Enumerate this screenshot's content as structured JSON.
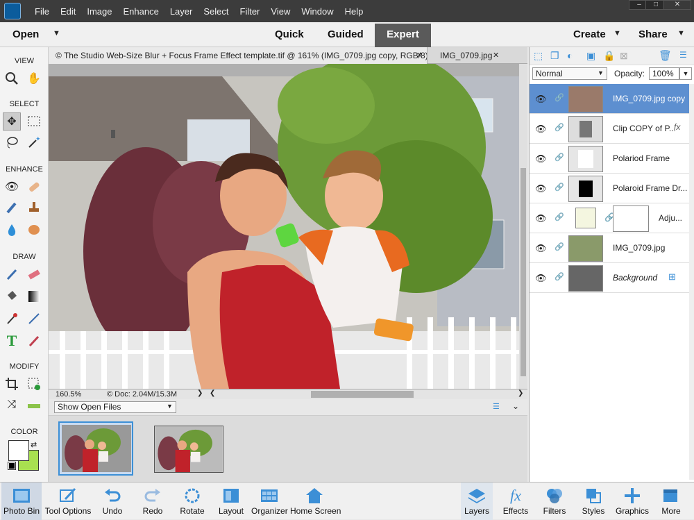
{
  "menubar": {
    "items": [
      "File",
      "Edit",
      "Image",
      "Enhance",
      "Layer",
      "Select",
      "Filter",
      "View",
      "Window",
      "Help"
    ],
    "window_controls": [
      "–",
      "□",
      "✕"
    ]
  },
  "modebar": {
    "open_label": "Open",
    "modes": [
      "Quick",
      "Guided",
      "Expert"
    ],
    "create_label": "Create",
    "share_label": "Share"
  },
  "toolbox": {
    "sections": [
      "VIEW",
      "SELECT",
      "ENHANCE",
      "DRAW",
      "MODIFY",
      "COLOR"
    ]
  },
  "tabs": {
    "active": "© The Studio Web-Size Blur + Focus Frame Effect template.tif @ 161% (IMG_0709.jpg copy, RGB/8) *",
    "other": "IMG_0709.jpg"
  },
  "status": {
    "zoom": "160.5%",
    "doc": "© Doc: 2.04M/15.3M"
  },
  "bin": {
    "dropdown": "Show Open Files"
  },
  "layers": {
    "blend_mode": "Normal",
    "opacity_label": "Opacity:",
    "opacity_value": "100%",
    "rows": [
      {
        "name": "IMG_0709.jpg copy"
      },
      {
        "name": "Clip COPY of P...",
        "fx": "fx"
      },
      {
        "name": "Polariod Frame"
      },
      {
        "name": "Polaroid Frame Dr..."
      },
      {
        "name": "Adju..."
      },
      {
        "name": "IMG_0709.jpg"
      },
      {
        "name": "Background"
      }
    ]
  },
  "bottombar": {
    "left": [
      "Photo Bin",
      "Tool Options",
      "Undo",
      "Redo",
      "Rotate",
      "Layout",
      "Organizer",
      "Home Screen"
    ],
    "right": [
      "Layers",
      "Effects",
      "Filters",
      "Styles",
      "Graphics",
      "More"
    ]
  },
  "colors": {
    "accent": "#3c8fd6",
    "selected_row": "#5d8fd0",
    "background_swatch": "#a8e050"
  }
}
